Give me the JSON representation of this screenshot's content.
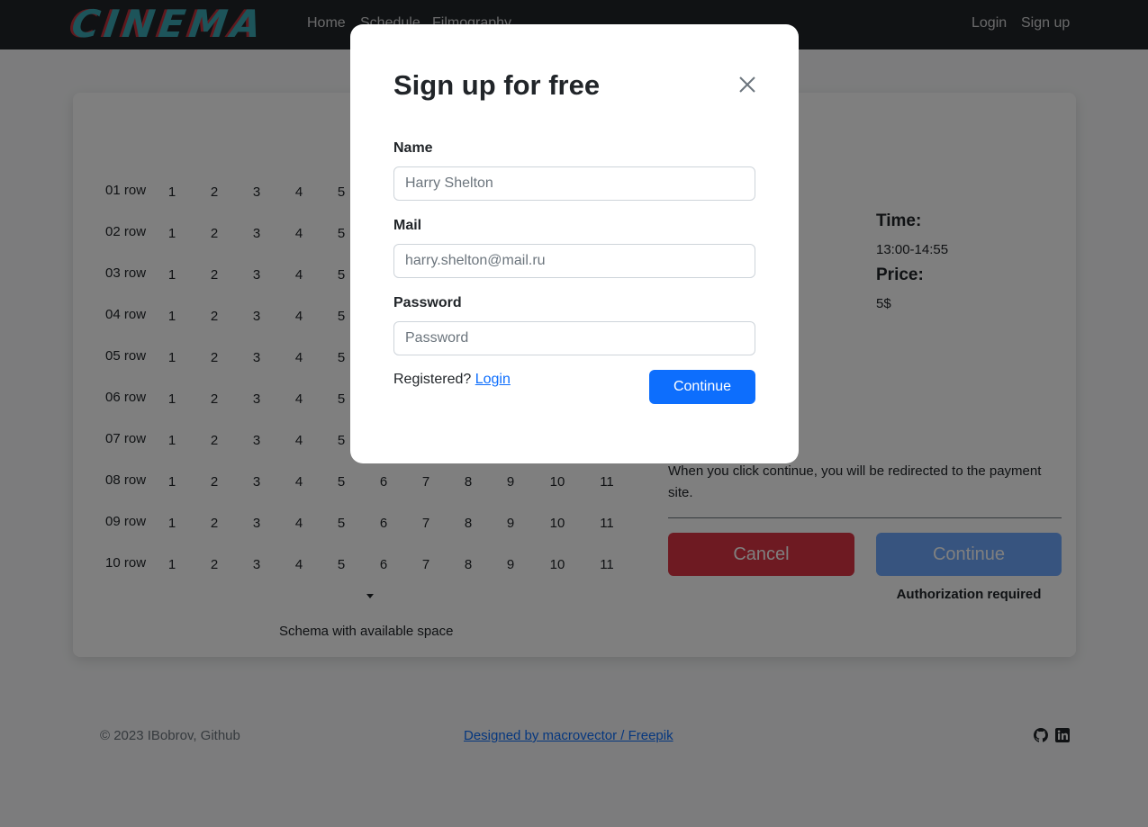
{
  "navbar": {
    "logo": "CINEMA",
    "links": {
      "home": "Home",
      "schedule": "Schedule",
      "filmography": "Filmography"
    },
    "login": "Login",
    "signup": "Sign up"
  },
  "schema": {
    "rows": [
      {
        "label": "01 row",
        "seats": [
          "1",
          "2",
          "3",
          "4",
          "5"
        ]
      },
      {
        "label": "02 row",
        "seats": [
          "1",
          "2",
          "3",
          "4",
          "5"
        ]
      },
      {
        "label": "03 row",
        "seats": [
          "1",
          "2",
          "3",
          "4",
          "5"
        ]
      },
      {
        "label": "04 row",
        "seats": [
          "1",
          "2",
          "3",
          "4",
          "5"
        ]
      },
      {
        "label": "05 row",
        "seats": [
          "1",
          "2",
          "3",
          "4",
          "5"
        ]
      },
      {
        "label": "06 row",
        "seats": [
          "1",
          "2",
          "3",
          "4",
          "5"
        ]
      },
      {
        "label": "07 row",
        "seats": [
          "1",
          "2",
          "3",
          "4",
          "5"
        ]
      },
      {
        "label": "08 row",
        "seats": [
          "1",
          "2",
          "3",
          "4",
          "5",
          "6",
          "7",
          "8",
          "9",
          "10",
          "11"
        ]
      },
      {
        "label": "09 row",
        "seats": [
          "1",
          "2",
          "3",
          "4",
          "5",
          "6",
          "7",
          "8",
          "9",
          "10",
          "11"
        ]
      },
      {
        "label": "10 row",
        "seats": [
          "1",
          "2",
          "3",
          "4",
          "5",
          "6",
          "7",
          "8",
          "9",
          "10",
          "11"
        ]
      }
    ],
    "caption": "Schema with available space"
  },
  "info": {
    "time_label": "Time:",
    "time_value": "13:00-14:55",
    "price_label": "Price:",
    "price_value": "5$",
    "redirect_text": "When you click continue, you will be redirected to the payment site.",
    "cancel": "Cancel",
    "continue": "Continue",
    "auth_required": "Authorization required"
  },
  "footer": {
    "copyright": "© 2023 IBobrov, Github",
    "designed": "Designed by macrovector / Freepik",
    "icons": [
      "github-icon",
      "linkedin-icon"
    ]
  },
  "modal": {
    "title": "Sign up for free",
    "name_label": "Name",
    "name_placeholder": "Harry Shelton",
    "mail_label": "Mail",
    "mail_placeholder": "harry.shelton@mail.ru",
    "password_label": "Password",
    "password_placeholder": "Password",
    "registered_text": "Registered?",
    "login_link": "Login",
    "continue": "Continue"
  },
  "colors": {
    "navbar": "#212529",
    "primary": "#0d6efd",
    "primary_disabled": "#6ea8fe",
    "danger": "#dc3545"
  }
}
